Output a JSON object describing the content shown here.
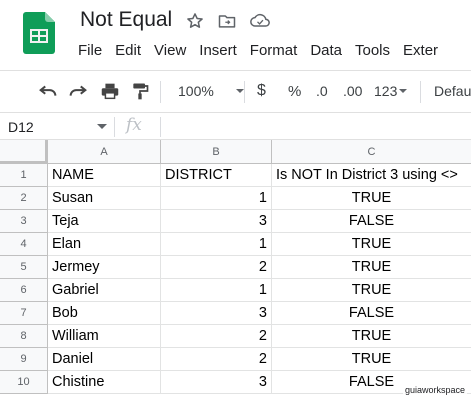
{
  "app": {
    "title": "Not Equal",
    "menu": [
      "File",
      "Edit",
      "View",
      "Insert",
      "Format",
      "Data",
      "Tools",
      "Exter"
    ],
    "brand_color": "#0f9d58"
  },
  "toolbar": {
    "zoom": "100%",
    "currency": "$",
    "percent": "%",
    "decimal_decrease": ".0",
    "decimal_increase": ".00",
    "number_format": "123",
    "font": "Defau",
    "icons": [
      "undo-icon",
      "redo-icon",
      "print-icon",
      "paint-format-icon"
    ]
  },
  "formula_bar": {
    "cell_ref": "D12",
    "fx": "fx",
    "value": ""
  },
  "grid": {
    "columns": [
      "A",
      "B",
      "C"
    ],
    "rows": [
      {
        "num": "1",
        "a": "NAME",
        "b": "DISTRICT",
        "c": "Is NOT In District 3 using <>"
      },
      {
        "num": "2",
        "a": "Susan",
        "b": "1",
        "c": "TRUE"
      },
      {
        "num": "3",
        "a": "Teja",
        "b": "3",
        "c": "FALSE"
      },
      {
        "num": "4",
        "a": "Elan",
        "b": "1",
        "c": "TRUE"
      },
      {
        "num": "5",
        "a": "Jermey",
        "b": "2",
        "c": "TRUE"
      },
      {
        "num": "6",
        "a": "Gabriel",
        "b": "1",
        "c": "TRUE"
      },
      {
        "num": "7",
        "a": "Bob",
        "b": "3",
        "c": "FALSE"
      },
      {
        "num": "8",
        "a": "William",
        "b": "2",
        "c": "TRUE"
      },
      {
        "num": "9",
        "a": "Daniel",
        "b": "2",
        "c": "TRUE"
      },
      {
        "num": "10",
        "a": "Chistine",
        "b": "3",
        "c": "FALSE"
      }
    ]
  },
  "watermark": "guiaworkspace"
}
